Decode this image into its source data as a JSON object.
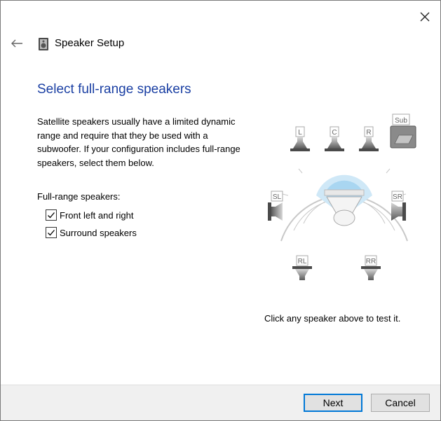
{
  "window": {
    "title": "Speaker Setup"
  },
  "page": {
    "heading": "Select full-range speakers",
    "description": "Satellite speakers usually have a limited dynamic range and require that they be used with a subwoofer.  If your configuration includes full-range speakers, select them below.",
    "group_label": "Full-range speakers:",
    "checkboxes": [
      {
        "label": "Front left and right",
        "checked": true
      },
      {
        "label": "Surround speakers",
        "checked": true
      }
    ],
    "test_hint": "Click any speaker above to test it."
  },
  "speakers": {
    "front_left": "L",
    "center": "C",
    "front_right": "R",
    "subwoofer": "Sub",
    "side_left": "SL",
    "side_right": "SR",
    "rear_left": "RL",
    "rear_right": "RR"
  },
  "buttons": {
    "next": "Next",
    "cancel": "Cancel"
  },
  "icons": {
    "close": "close-icon",
    "back": "back-arrow-icon",
    "app": "speaker-app-icon"
  },
  "colors": {
    "heading": "#1a3fa3",
    "primary_button_border": "#0078d7",
    "footer_bg": "#f0f0f0"
  }
}
